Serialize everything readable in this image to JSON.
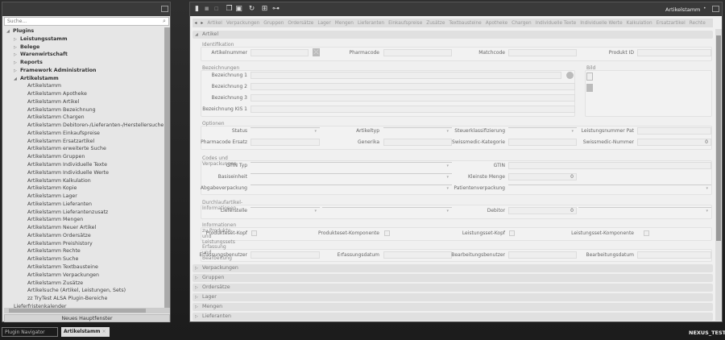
{
  "navigator": {
    "search_placeholder": "Suche...",
    "new_window": "Neues Hauptfenster",
    "tree": [
      {
        "label": "Plugins",
        "level": 0,
        "bold": true,
        "state": "open"
      },
      {
        "label": "Leistungsstamm",
        "level": 1,
        "bold": true,
        "state": "closed"
      },
      {
        "label": "Belege",
        "level": 1,
        "bold": true,
        "state": "closed"
      },
      {
        "label": "Warenwirtschaft",
        "level": 1,
        "bold": true,
        "state": "closed"
      },
      {
        "label": "Reports",
        "level": 1,
        "bold": true,
        "state": "closed"
      },
      {
        "label": "Framework Administration",
        "level": 1,
        "bold": true,
        "state": "closed"
      },
      {
        "label": "Artikelstamm",
        "level": 1,
        "bold": true,
        "state": "open"
      },
      {
        "label": "Artikelstamm",
        "level": 2
      },
      {
        "label": "Artikelstamm Apotheke",
        "level": 2
      },
      {
        "label": "Artikelstamm Artikel",
        "level": 2
      },
      {
        "label": "Artikelstamm Bezeichnung",
        "level": 2
      },
      {
        "label": "Artikelstamm Chargen",
        "level": 2
      },
      {
        "label": "Artikelstamm Debitoren-/Lieferanten-/Herstellersuche",
        "level": 2
      },
      {
        "label": "Artikelstamm Einkaufspreise",
        "level": 2
      },
      {
        "label": "Artikelstamm Ersatzartikel",
        "level": 2
      },
      {
        "label": "Artikelstamm erweiterte Suche",
        "level": 2
      },
      {
        "label": "Artikelstamm Gruppen",
        "level": 2
      },
      {
        "label": "Artikelstamm Individuelle Texte",
        "level": 2
      },
      {
        "label": "Artikelstamm Individuelle Werte",
        "level": 2
      },
      {
        "label": "Artikelstamm Kalkulation",
        "level": 2
      },
      {
        "label": "Artikelstamm Kopie",
        "level": 2
      },
      {
        "label": "Artikelstamm Lager",
        "level": 2
      },
      {
        "label": "Artikelstamm Lieferanten",
        "level": 2
      },
      {
        "label": "Artikelstamm Lieferantenzusatz",
        "level": 2
      },
      {
        "label": "Artikelstamm Mengen",
        "level": 2
      },
      {
        "label": "Artikelstamm Neuer Artikel",
        "level": 2
      },
      {
        "label": "Artikelstamm Ordersätze",
        "level": 2
      },
      {
        "label": "Artikelstamm Preishistory",
        "level": 2
      },
      {
        "label": "Artikelstamm Rechte",
        "level": 2
      },
      {
        "label": "Artikelstamm Suche",
        "level": 2
      },
      {
        "label": "Artikelstamm Textbausteine",
        "level": 2
      },
      {
        "label": "Artikelstamm Verpackungen",
        "level": 2
      },
      {
        "label": "Artikelstamm Zusätze",
        "level": 2
      },
      {
        "label": "Artikelsuche (Artikel, Leistungen, Sets)",
        "level": 2
      },
      {
        "label": "zz TryTest ALSA Plugin-Bereiche",
        "level": 2
      },
      {
        "label": "Lieferfristenkalender",
        "level": 1
      }
    ]
  },
  "main": {
    "title": "Artikelstamm",
    "tabs": [
      "Artikel",
      "Verpackungen",
      "Gruppen",
      "Ordersätze",
      "Lager",
      "Mengen",
      "Lieferanten",
      "Einkaufspreise",
      "Zusätze",
      "Textbausteine",
      "Apotheke",
      "Chargen",
      "Individuelle Texte",
      "Individuelle Werte",
      "Kalkulation",
      "Ersatzartikel",
      "Rechte"
    ],
    "section_open": "Artikel",
    "sections": {
      "identifikation": {
        "title": "Identifikation",
        "artikelnummer": "Artikelnummer",
        "pharmacode": "Pharmacode",
        "matchcode": "Matchcode",
        "produkt_id": "Produkt ID"
      },
      "bezeichnungen": {
        "title": "Bezeichnungen",
        "b1": "Bezeichnung 1",
        "b2": "Bezeichnung 2",
        "b3": "Bezeichnung 3",
        "kis": "Bezeichnung KIS 1",
        "bild": "Bild"
      },
      "optionen": {
        "title": "Optionen",
        "status": "Status",
        "artikeltyp": "Artikeltyp",
        "steuer": "Steuerklassifizierung",
        "leistungsnummer": "Leistungsnummer Pat",
        "pharmacode_ersatz": "Pharmacode Ersatz",
        "generika": "Generika",
        "swissmedic_kat": "Swissmedic-Kategorie",
        "swissmedic_nr": "Swissmedic-Nummer",
        "swissmedic_nr_value": "0"
      },
      "codes": {
        "title": "Codes und Verpackungen",
        "gtin_typ": "GTIN Typ",
        "gtin": "GTIN",
        "basiseinheit": "Basiseinheit",
        "kleinste_menge": "Kleinste Menge",
        "kleinste_menge_value": "0",
        "abgabe": "Abgabeverpackung",
        "patienten": "Patientenverpackung"
      },
      "durchlauf": {
        "title": "Durchlaufartikel-Informationen",
        "lieferstelle": "Lieferstelle",
        "debitor": "Debitor",
        "debitor_value": "0"
      },
      "sets": {
        "title": "Informationen zu Produkte- und Leistungssets",
        "pk": "Produkteset-Kopf",
        "pkomp": "Produkteset-Komponente",
        "lk": "Leistungsset-Kopf",
        "lkomp": "Leistungsset-Komponente"
      },
      "erfassung": {
        "title": "Erfassung und Bearbeitung",
        "eb": "Erfassungsbenutzer",
        "ed": "Erfassungsdatum",
        "bb": "Bearbeitungsbenutzer",
        "bd": "Bearbeitungsdatum"
      }
    },
    "collapsed_sections": [
      "Verpackungen",
      "Gruppen",
      "Ordersätze",
      "Lager",
      "Mengen",
      "Lieferanten"
    ]
  },
  "taskbar": {
    "items": [
      "Plugin Navigator",
      "Artikelstamm"
    ],
    "env": "NEXUS_TEST"
  }
}
